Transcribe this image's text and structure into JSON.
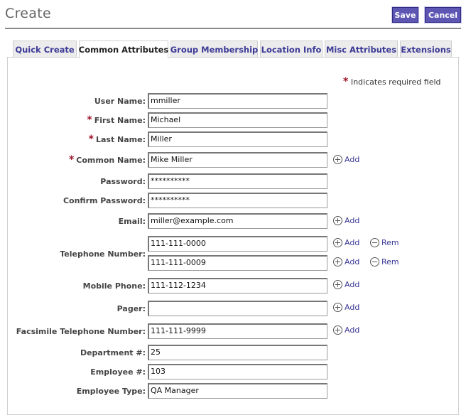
{
  "header": {
    "title": "Create",
    "save_label": "Save",
    "cancel_label": "Cancel"
  },
  "tabs": [
    {
      "label": "Quick Create",
      "active": false
    },
    {
      "label": "Common Attributes",
      "active": true
    },
    {
      "label": "Group Membership",
      "active": false
    },
    {
      "label": "Location Info",
      "active": false
    },
    {
      "label": "Misc Attributes",
      "active": false
    },
    {
      "label": "Extensions",
      "active": false
    }
  ],
  "form": {
    "required_star": "*",
    "required_note": "Indicates required field",
    "add_label": "Add",
    "remove_label": "Rem",
    "fields": {
      "user_name": {
        "label": "User Name:",
        "value": "mmiller"
      },
      "first_name": {
        "label": "First Name:",
        "value": "Michael"
      },
      "last_name": {
        "label": "Last Name:",
        "value": "Miller"
      },
      "common_name": {
        "label": "Common Name:",
        "value": "Mike Miller"
      },
      "password": {
        "label": "Password:",
        "value": "**********"
      },
      "confirm_password": {
        "label": "Confirm Password:",
        "value": "**********"
      },
      "email": {
        "label": "Email:",
        "value": "miller@example.com"
      },
      "telephone": {
        "label": "Telephone Number:",
        "values": [
          "111-111-0000",
          "111-111-0009"
        ]
      },
      "mobile_phone": {
        "label": "Mobile Phone:",
        "value": "111-112-1234"
      },
      "pager": {
        "label": "Pager:",
        "value": ""
      },
      "fax": {
        "label": "Facsimile Telephone Number:",
        "value": "111-111-9999"
      },
      "department": {
        "label": "Department #:",
        "value": "25"
      },
      "employee_num": {
        "label": "Employee #:",
        "value": "103"
      },
      "employee_type": {
        "label": "Employee Type:",
        "value": "QA Manager"
      }
    }
  },
  "colors": {
    "accent": "#5d56b3",
    "link": "#3d3a96",
    "required": "#a0152a"
  }
}
